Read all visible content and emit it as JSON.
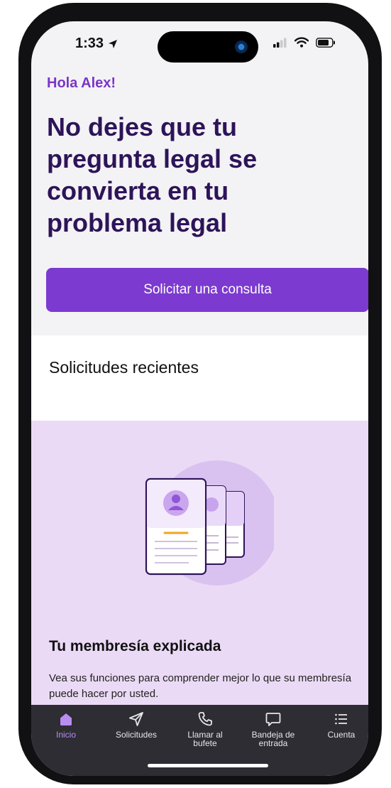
{
  "status_bar": {
    "time": "1:33"
  },
  "home": {
    "greeting": "Hola Alex!",
    "headline": "No dejes que tu pregunta legal se convierta en tu problema legal",
    "cta_label": "Solicitar una consulta"
  },
  "recent_requests": {
    "title": "Solicitudes recientes"
  },
  "membership": {
    "title": "Tu membresía explicada",
    "description": "Vea sus funciones para comprender mejor lo que su membresía puede hacer por usted."
  },
  "tab_bar": {
    "items": [
      {
        "label": "Inicio",
        "icon": "home-icon",
        "active": true
      },
      {
        "label": "Solicitudes",
        "icon": "send-icon",
        "active": false
      },
      {
        "label": "Llamar al\nbufete",
        "icon": "phone-icon",
        "active": false
      },
      {
        "label": "Bandeja de\nentrada",
        "icon": "message-icon",
        "active": false
      },
      {
        "label": "Cuenta",
        "icon": "menu-list-icon",
        "active": false
      }
    ]
  },
  "colors": {
    "accent": "#7c3ad0",
    "headline": "#2d1458",
    "membership_bg": "#ebdaf5",
    "tab_bar_bg": "#2d2d33",
    "tab_active": "#b98cf0"
  }
}
